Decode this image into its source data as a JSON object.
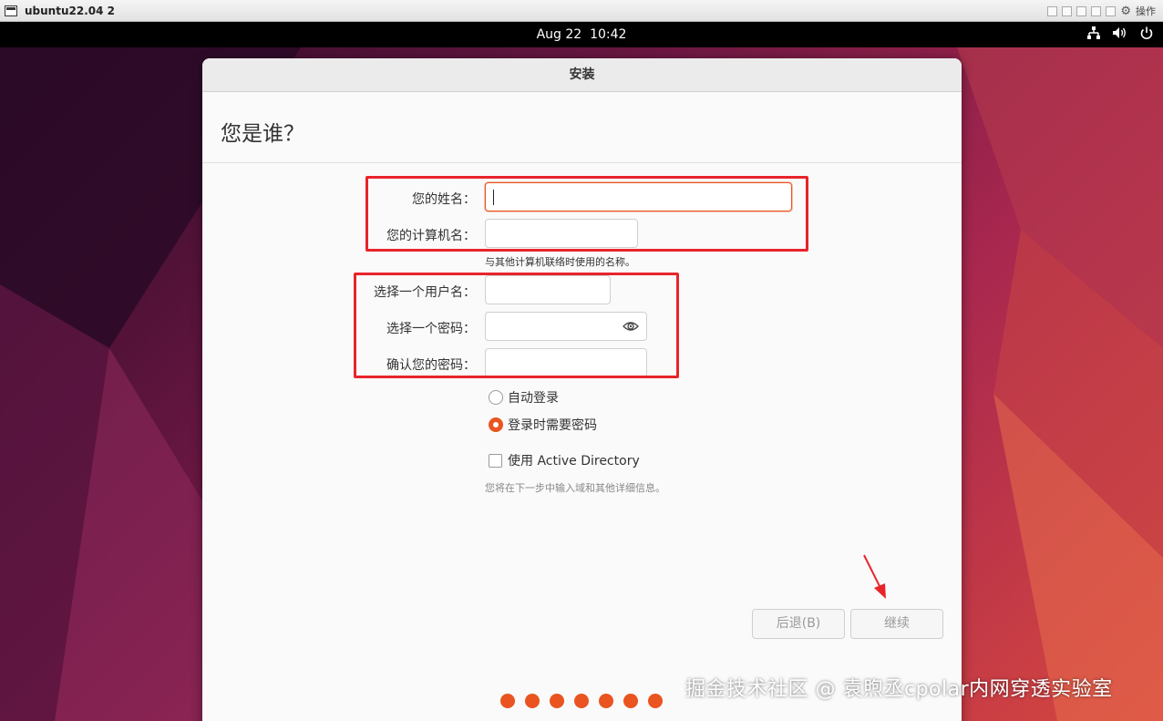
{
  "vm_window": {
    "title": "ubuntu22.04 2",
    "ops_label": "操作"
  },
  "top_panel": {
    "date": "Aug 22",
    "time": "10:42"
  },
  "installer": {
    "title": "安装",
    "heading": "您是谁？",
    "fields": {
      "name": {
        "label": "您的姓名：",
        "value": ""
      },
      "computer_name": {
        "label": "您的计算机名：",
        "value": "",
        "hint": "与其他计算机联络时使用的名称。"
      },
      "username": {
        "label": "选择一个用户名：",
        "value": ""
      },
      "password": {
        "label": "选择一个密码：",
        "value": ""
      },
      "confirm_password": {
        "label": "确认您的密码：",
        "value": ""
      }
    },
    "login_options": {
      "auto_login": {
        "label": "自动登录",
        "selected": false
      },
      "require_password": {
        "label": "登录时需要密码",
        "selected": true
      }
    },
    "active_directory": {
      "label": "使用 Active Directory",
      "checked": false,
      "hint": "您将在下一步中输入域和其他详细信息。"
    },
    "buttons": {
      "back": "后退(B)",
      "continue": "继续"
    },
    "progress_dots": 7,
    "accent_color": "#e95420"
  },
  "annotation_color": "#e8242b",
  "watermark": "掘金技术社区 @ 袁煦丞cpolar内网穿透实验室"
}
